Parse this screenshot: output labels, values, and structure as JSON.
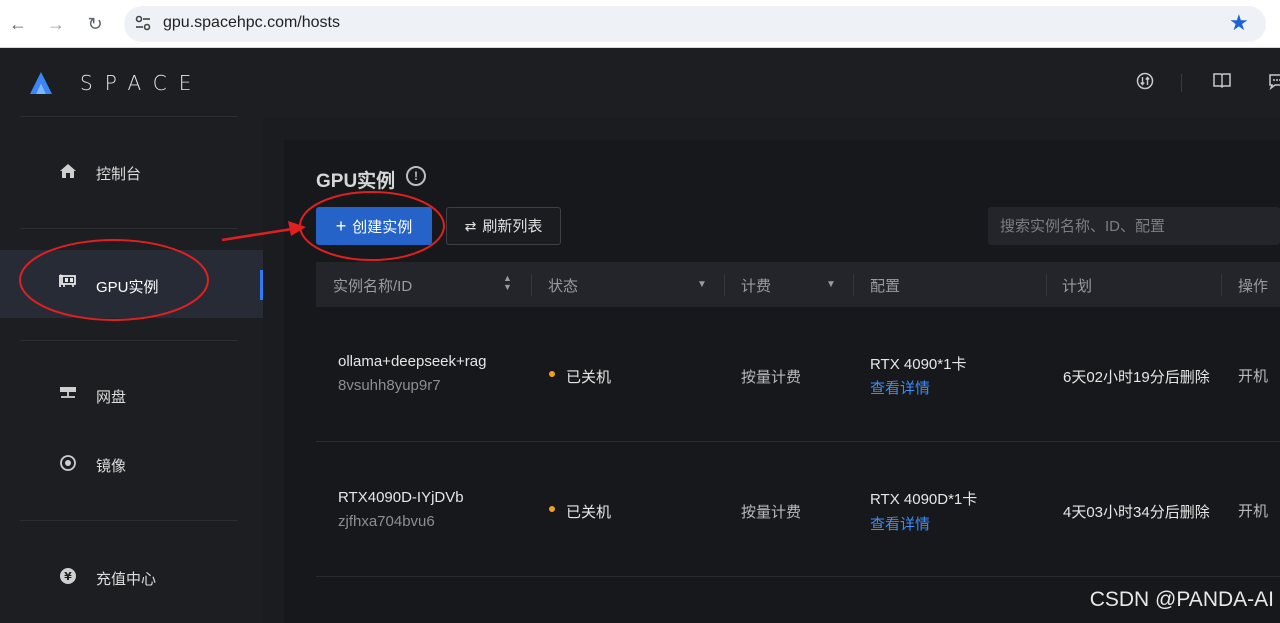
{
  "browser": {
    "url": "gpu.spacehpc.com/hosts"
  },
  "brand": {
    "logo_text": "SPACE"
  },
  "sidebar": {
    "items": [
      {
        "label": "控制台",
        "icon": "home-icon"
      },
      {
        "label": "GPU实例",
        "icon": "gpu-icon",
        "active": true
      },
      {
        "label": "网盘",
        "icon": "network-disk-icon"
      },
      {
        "label": "镜像",
        "icon": "image-target-icon"
      },
      {
        "label": "充值中心",
        "icon": "yen-icon"
      }
    ]
  },
  "page": {
    "title": "GPU实例",
    "create_label": "创建实例",
    "refresh_label": "刷新列表",
    "search_placeholder": "搜索实例名称、ID、配置"
  },
  "table": {
    "headers": [
      "实例名称/ID",
      "状态",
      "计费",
      "配置",
      "计划",
      "操作"
    ],
    "rows": [
      {
        "name": "ollama+deepseek+rag",
        "id": "8vsuhh8yup9r7",
        "status": "已关机",
        "billing": "按量计费",
        "config": "RTX 4090*1卡",
        "detail": "查看详情",
        "plan": "6天02小时19分后删除",
        "action": "开机"
      },
      {
        "name": "RTX4090D-IYjDVb",
        "id": "zjfhxa704bvu6",
        "status": "已关机",
        "billing": "按量计费",
        "config": "RTX 4090D*1卡",
        "detail": "查看详情",
        "plan": "4天03小时34分后删除",
        "action": "开机"
      }
    ]
  },
  "watermark": "CSDN @PANDA-AI",
  "colors": {
    "accent": "#2563c8",
    "link": "#3d8bf7",
    "status_off": "#f0a020",
    "annotation": "#e02020"
  }
}
